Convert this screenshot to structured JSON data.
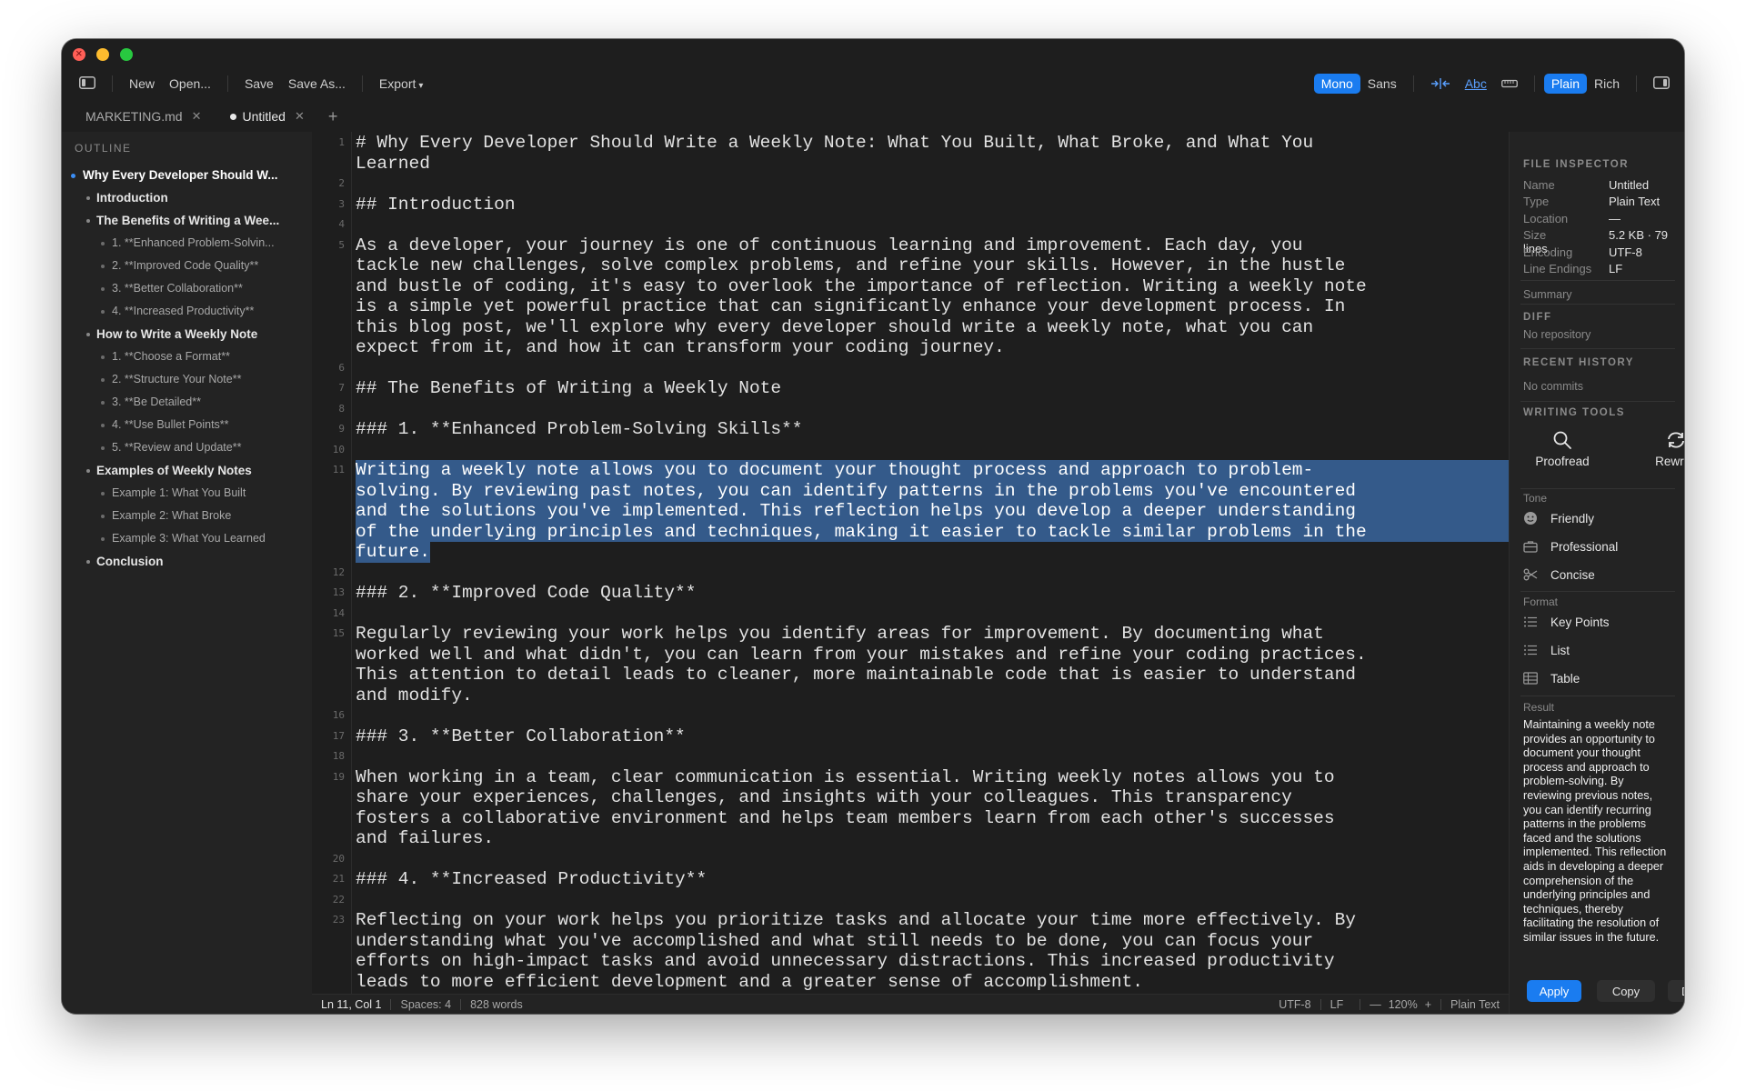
{
  "toolbar": {
    "new": "New",
    "open": "Open...",
    "save": "Save",
    "save_as": "Save As...",
    "export": "Export",
    "font_mono": "Mono",
    "font_sans": "Sans",
    "wrap_label": "Abc",
    "mode_plain": "Plain",
    "mode_rich": "Rich"
  },
  "tabs": [
    {
      "label": "MARKETING.md"
    },
    {
      "label": "Untitled"
    }
  ],
  "outline": {
    "title": "OUTLINE",
    "items": [
      {
        "text": "Why Every Developer Should W...",
        "level": 1
      },
      {
        "text": "Introduction",
        "level": 2
      },
      {
        "text": "The Benefits of Writing a Wee...",
        "level": 2
      },
      {
        "text": "1. **Enhanced Problem-Solvin...",
        "level": 3
      },
      {
        "text": "2. **Improved Code Quality**",
        "level": 3
      },
      {
        "text": "3. **Better Collaboration**",
        "level": 3
      },
      {
        "text": "4. **Increased Productivity**",
        "level": 3
      },
      {
        "text": "How to Write a Weekly Note",
        "level": 2
      },
      {
        "text": "1. **Choose a Format**",
        "level": 3
      },
      {
        "text": "2. **Structure Your Note**",
        "level": 3
      },
      {
        "text": "3. **Be Detailed**",
        "level": 3
      },
      {
        "text": "4. **Use Bullet Points**",
        "level": 3
      },
      {
        "text": "5. **Review and Update**",
        "level": 3
      },
      {
        "text": "Examples of Weekly Notes",
        "level": 2
      },
      {
        "text": "Example 1: What You Built",
        "level": 3
      },
      {
        "text": "Example 2: What Broke",
        "level": 3
      },
      {
        "text": "Example 3: What You Learned",
        "level": 3
      },
      {
        "text": "Conclusion",
        "level": 2
      }
    ]
  },
  "editor": {
    "line_numbers": [
      "1",
      "2",
      "3",
      "4",
      "5",
      "6",
      "7",
      "8",
      "9",
      "10",
      "11",
      "12",
      "13",
      "14",
      "15",
      "16",
      "17",
      "18",
      "19",
      "20",
      "21",
      "22",
      "23"
    ],
    "lines": [
      {
        "text": "# Why Every Developer Should Write a Weekly Note: What You Built, What Broke, and What You",
        "selected": false
      },
      {
        "text": "Learned",
        "selected": false
      },
      {
        "text": "## Introduction",
        "selected": false
      },
      {
        "text": "As a developer, your journey is one of continuous learning and improvement. Each day, you",
        "selected": false
      },
      {
        "text": "tackle new challenges, solve complex problems, and refine your skills. However, in the hustle",
        "selected": false
      },
      {
        "text": "and bustle of coding, it's easy to overlook the importance of reflection. Writing a weekly note",
        "selected": false
      },
      {
        "text": "is a simple yet powerful practice that can significantly enhance your development process. In",
        "selected": false
      },
      {
        "text": "this blog post, we'll explore why every developer should write a weekly note, what you can",
        "selected": false
      },
      {
        "text": "expect from it, and how it can transform your coding journey.",
        "selected": false
      },
      {
        "text": "## The Benefits of Writing a Weekly Note",
        "selected": false
      },
      {
        "text": "### 1. **Enhanced Problem-Solving Skills**",
        "selected": false
      },
      {
        "text": "Writing a weekly note allows you to document your thought process and approach to problem-",
        "selected": true
      },
      {
        "text": "solving. By reviewing past notes, you can identify patterns in the problems you've encountered",
        "selected": true
      },
      {
        "text": "and the solutions you've implemented. This reflection helps you develop a deeper understanding",
        "selected": true
      },
      {
        "text": "of the underlying principles and techniques, making it easier to tackle similar problems in the",
        "selected": true
      },
      {
        "text": "future.",
        "selected": true
      },
      {
        "text": "### 2. **Improved Code Quality**",
        "selected": false
      },
      {
        "text": "Regularly reviewing your work helps you identify areas for improvement. By documenting what",
        "selected": false
      },
      {
        "text": "worked well and what didn't, you can learn from your mistakes and refine your coding practices.",
        "selected": false
      },
      {
        "text": "This attention to detail leads to cleaner, more maintainable code that is easier to understand",
        "selected": false
      },
      {
        "text": "and modify.",
        "selected": false
      },
      {
        "text": "### 3. **Better Collaboration**",
        "selected": false
      },
      {
        "text": "When working in a team, clear communication is essential. Writing weekly notes allows you to",
        "selected": false
      },
      {
        "text": "share your experiences, challenges, and insights with your colleagues. This transparency",
        "selected": false
      },
      {
        "text": "fosters a collaborative environment and helps team members learn from each other's successes",
        "selected": false
      },
      {
        "text": "and failures.",
        "selected": false
      },
      {
        "text": "### 4. **Increased Productivity**",
        "selected": false
      },
      {
        "text": "Reflecting on your work helps you prioritize tasks and allocate your time more effectively. By",
        "selected": false
      },
      {
        "text": "understanding what you've accomplished and what still needs to be done, you can focus your",
        "selected": false
      },
      {
        "text": "efforts on high-impact tasks and avoid unnecessary distractions. This increased productivity",
        "selected": false
      },
      {
        "text": "leads to more efficient development and a greater sense of accomplishment.",
        "selected": false
      }
    ]
  },
  "inspector": {
    "file_title": "FILE INSPECTOR",
    "fields": [
      {
        "k": "Name",
        "v": "Untitled"
      },
      {
        "k": "Type",
        "v": "Plain Text"
      },
      {
        "k": "Location",
        "v": "—"
      },
      {
        "k": "Size",
        "v": "5.2 KB · 79 lines"
      },
      {
        "k": "Encoding",
        "v": "UTF-8"
      },
      {
        "k": "Line Endings",
        "v": "LF"
      }
    ],
    "summary": "Summary",
    "diff_title": "DIFF",
    "diff_value": "No repository",
    "history_title": "RECENT HISTORY",
    "history_value": "No commits",
    "tools_title": "WRITING TOOLS",
    "proofread": "Proofread",
    "rewrite": "Rewrite",
    "tone_label": "Tone",
    "tone_items": [
      "Friendly",
      "Professional",
      "Concise"
    ],
    "format_label": "Format",
    "format_items": [
      "Key Points",
      "List",
      "Table"
    ],
    "result_label": "Result",
    "result_text": "Maintaining a weekly note provides an opportunity to document your thought process and approach to problem-solving. By reviewing previous notes, you can identify recurring patterns in the problems faced and the solutions implemented. This reflection aids in developing a deeper comprehension of the underlying principles and techniques, thereby facilitating the resolution of similar issues in the future.",
    "apply": "Apply",
    "copy": "Copy",
    "discard": "Discard"
  },
  "status": {
    "position": "Ln 11, Col 1",
    "spaces": "Spaces: 4",
    "words": "828 words",
    "encoding": "UTF-8",
    "line_endings": "LF",
    "zoom": "120%",
    "syntax": "Plain Text"
  }
}
